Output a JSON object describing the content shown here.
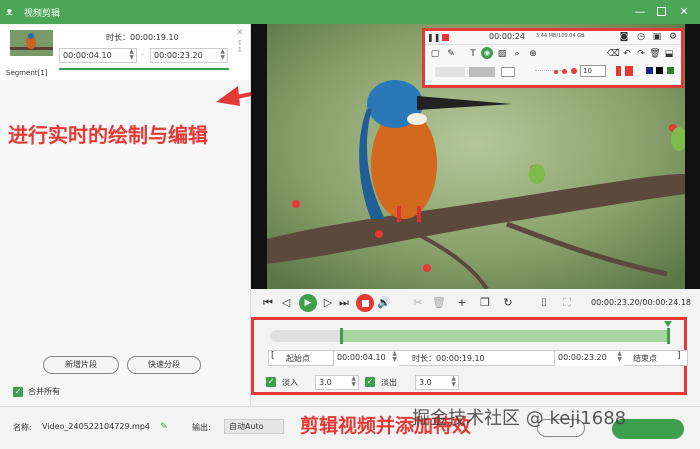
{
  "window": {
    "title": "视频剪辑"
  },
  "segment": {
    "duration_label": "时长：",
    "duration": "00:00:19.10",
    "start_time": "00:00:04.10",
    "separator": "-",
    "end_time": "00:00:23.20",
    "name": "Segment[1]"
  },
  "annotations": {
    "top": "进行实时的绘制与编辑",
    "bottom": "剪辑视频并添加特效"
  },
  "left_actions": {
    "new_segment": "新增片段",
    "quick_split": "快速分段",
    "merge_all": "合并所有"
  },
  "drawbar": {
    "time": "00:00:24",
    "size_info": "3.44 MB/109.04 GB",
    "font_size_value": "10",
    "colors": [
      "#e53935",
      "#e53935",
      "#e53935",
      "#ffffff",
      "#e53935",
      "#ffffff",
      "#1a237e",
      "#000000",
      "#2e7d32"
    ]
  },
  "player": {
    "time_display": "00:00:23.20/00:00:24.18"
  },
  "edit": {
    "start_label": "起始点",
    "start_value": "00:00:04.10",
    "duration_label": "时长：00:00:19.10",
    "end_value": "00:00:23.20",
    "end_label": "结束点",
    "fade_in_label": "淡入",
    "fade_in_value": "3.0",
    "fade_out_label": "淡出",
    "fade_out_value": "3.0"
  },
  "bottom": {
    "name_label": "名称:",
    "filename": "Video_240522104729.mp4",
    "output_label": "输出:",
    "output_value": "自动Auto",
    "watermark": "掘金技术社区 @ keji1688"
  },
  "theme": {
    "accent": "#4ba657",
    "highlight": "#e53935"
  }
}
